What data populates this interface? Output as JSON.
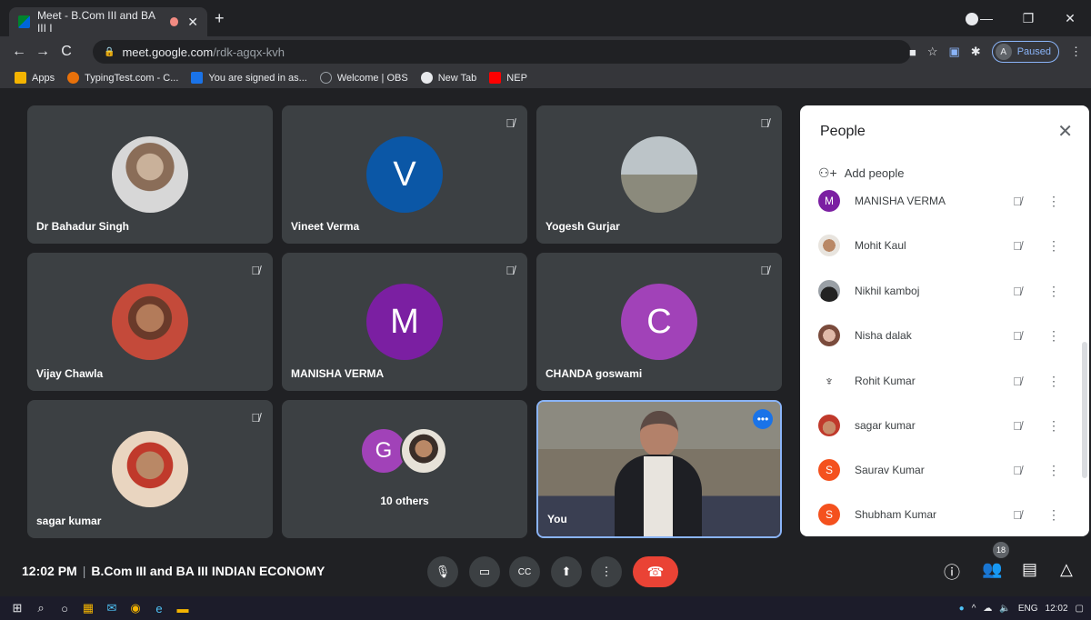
{
  "browser": {
    "tab_title": "Meet - B.Com III and BA III I",
    "tab_close": "✕",
    "new_tab": "+",
    "url_host": "meet.google.com",
    "url_path": "/rdk-agqx-kvh",
    "profile_initial": "A",
    "profile_status": "Paused",
    "window_controls": [
      "—",
      "❐",
      "✕"
    ]
  },
  "bookmarks": [
    {
      "label": "Apps",
      "icon": "apps-grid-icon",
      "color": "#f4b400"
    },
    {
      "label": "TypingTest.com - C...",
      "icon": "typingtest-icon",
      "color": "#e8710a"
    },
    {
      "label": "You are signed in as...",
      "icon": "s-icon",
      "color": "#1a73e8"
    },
    {
      "label": "Welcome | OBS",
      "icon": "obs-icon",
      "color": "#5f6368"
    },
    {
      "label": "New Tab",
      "icon": "chrome-icon",
      "color": "#e8eaed"
    },
    {
      "label": "NEP",
      "icon": "youtube-icon",
      "color": "#ff0000"
    }
  ],
  "tiles": [
    {
      "name": "Dr Bahadur Singh",
      "avatar_type": "photo",
      "muted": false
    },
    {
      "name": "Vineet Verma",
      "avatar_type": "letter",
      "letter": "V",
      "color": "#0b57a6",
      "muted": true
    },
    {
      "name": "Yogesh Gurjar",
      "avatar_type": "photo",
      "muted": true
    },
    {
      "name": "Vijay Chawla",
      "avatar_type": "photo",
      "muted": true
    },
    {
      "name": "MANISHA VERMA",
      "avatar_type": "letter",
      "letter": "M",
      "color": "#7b1fa2",
      "muted": true
    },
    {
      "name": "CHANDA goswami",
      "avatar_type": "letter",
      "letter": "C",
      "color": "#a142b8",
      "muted": true
    },
    {
      "name": "sagar kumar",
      "avatar_type": "photo",
      "muted": true
    },
    {
      "name": "10 others",
      "avatar_type": "group",
      "letter": "G",
      "muted": false
    },
    {
      "name": "You",
      "avatar_type": "video",
      "muted": false
    }
  ],
  "people_panel": {
    "title": "People",
    "add_people": "Add people",
    "participants": [
      {
        "name": "MANISHA VERMA",
        "letter": "M",
        "color": "#7b1fa2"
      },
      {
        "name": "Mohit Kaul",
        "letter": "",
        "color": "#b98866"
      },
      {
        "name": "Nikhil kamboj",
        "letter": "",
        "color": "#4a4a4a"
      },
      {
        "name": "Nisha dalak",
        "letter": "",
        "color": "#c88b7a"
      },
      {
        "name": "Rohit Kumar",
        "letter": "",
        "color": "#ffffff"
      },
      {
        "name": "sagar kumar",
        "letter": "",
        "color": "#c0392b"
      },
      {
        "name": "Saurav Kumar",
        "letter": "S",
        "color": "#f4511e"
      },
      {
        "name": "Shubham Kumar",
        "letter": "S",
        "color": "#f4511e"
      }
    ]
  },
  "meeting_bar": {
    "time": "12:02 PM",
    "separator": "|",
    "title": "B.Com III and BA III INDIAN ECONOMY",
    "participant_count": "18"
  },
  "taskbar": {
    "language": "ENG",
    "clock": "12:02"
  }
}
